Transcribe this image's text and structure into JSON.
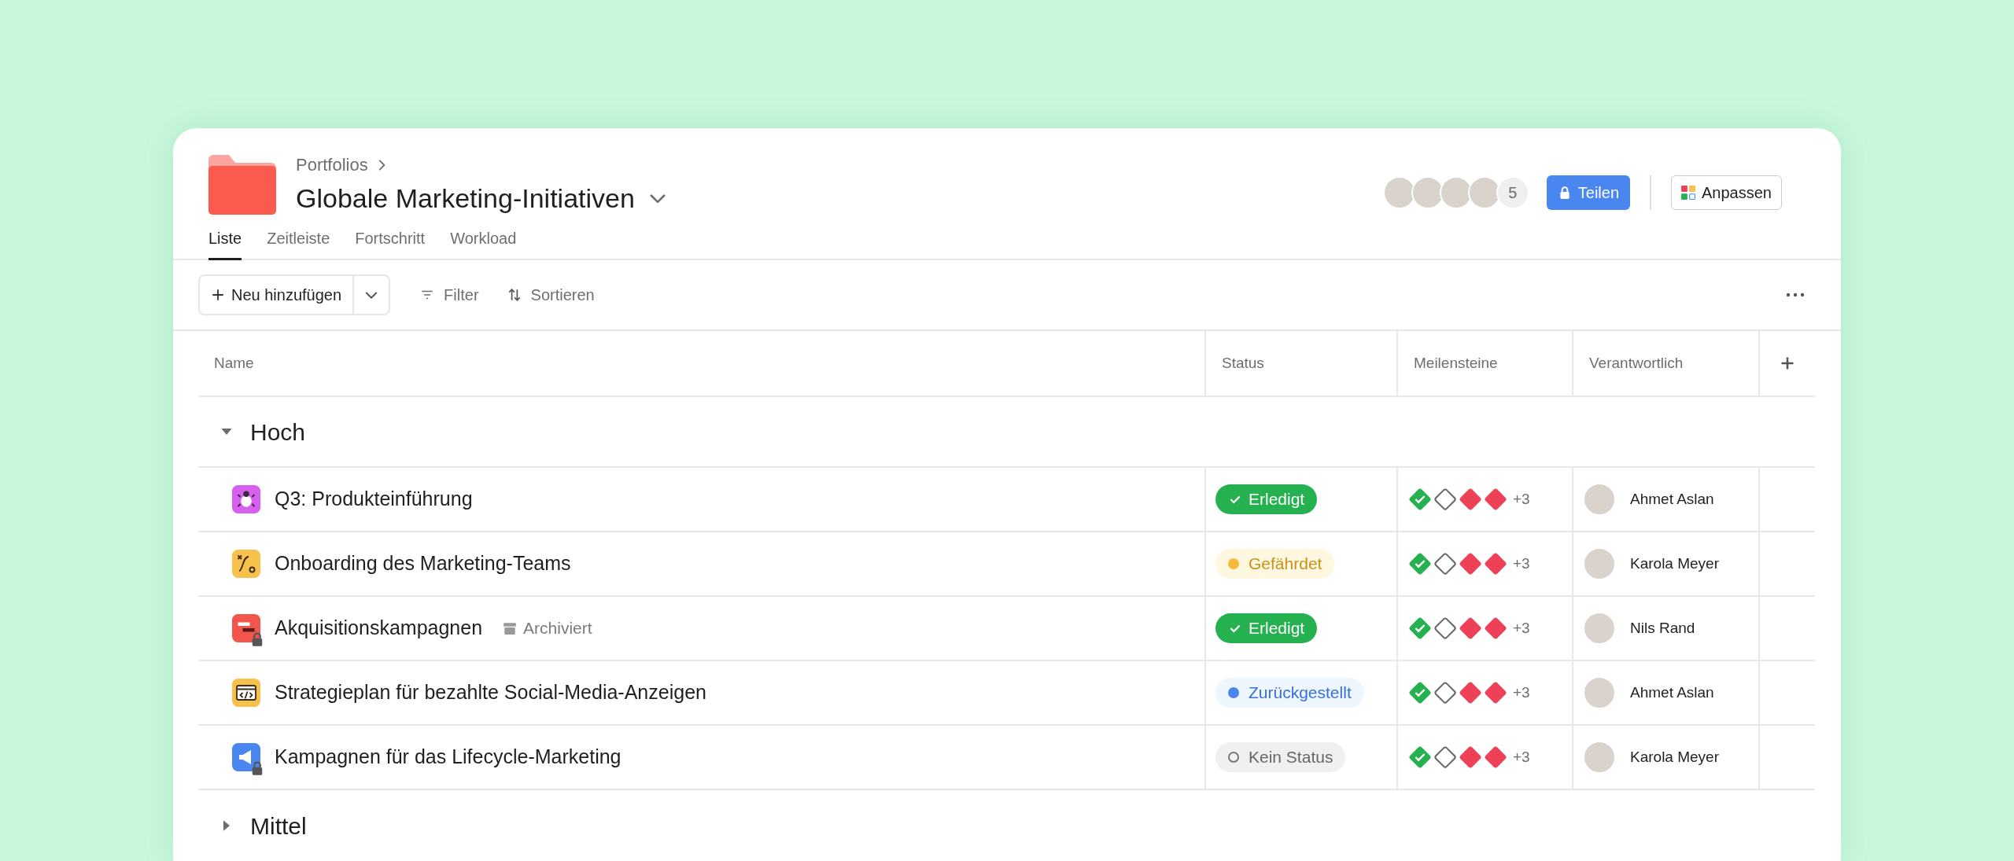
{
  "header": {
    "breadcrumb": "Portfolios",
    "title": "Globale Marketing-Initiativen",
    "member_count": "5",
    "share_button": "Teilen",
    "customize_button": "Anpassen"
  },
  "tabs": [
    {
      "label": "Liste",
      "selected": true
    },
    {
      "label": "Zeitleiste",
      "selected": false
    },
    {
      "label": "Fortschritt",
      "selected": false
    },
    {
      "label": "Workload",
      "selected": false
    }
  ],
  "toolbar": {
    "add_button": "Neu hinzufügen",
    "filter": "Filter",
    "sort": "Sortieren"
  },
  "table": {
    "columns": [
      "Name",
      "Status",
      "Meilensteine",
      "Verantwortlich"
    ],
    "groups": [
      {
        "title": "Hoch",
        "expanded": true,
        "rows": [
          {
            "name": "Q3: Produkteinführung",
            "kind": "bug",
            "color": "#d65fef",
            "locked": false,
            "status": {
              "kind": "done",
              "label": "Erledigt"
            },
            "milestones": [
              {
                "kind": "done"
              },
              {
                "kind": "open"
              },
              {
                "kind": "missed"
              },
              {
                "kind": "missed"
              }
            ],
            "more_milestones": "+3",
            "owner": "Ahmet Aslan"
          },
          {
            "name": "Onboarding des Marketing-Teams",
            "kind": "workflow",
            "color": "#f8c14c",
            "locked": false,
            "status": {
              "kind": "at_risk",
              "label": "Gefährdet"
            },
            "milestones": [
              {
                "kind": "done"
              },
              {
                "kind": "open"
              },
              {
                "kind": "missed"
              },
              {
                "kind": "missed"
              }
            ],
            "more_milestones": "+3",
            "owner": "Karola Meyer"
          },
          {
            "name": "Akquisitionskampagnen",
            "kind": "board",
            "color": "#f2554b",
            "locked": true,
            "archived_label": "Archiviert",
            "status": {
              "kind": "done",
              "label": "Erledigt"
            },
            "milestones": [
              {
                "kind": "done"
              },
              {
                "kind": "open"
              },
              {
                "kind": "missed"
              },
              {
                "kind": "missed"
              }
            ],
            "more_milestones": "+3",
            "owner": "Nils Rand"
          },
          {
            "name": "Strategieplan für bezahlte Social-Media-Anzeigen",
            "kind": "code",
            "color": "#f8c14c",
            "locked": false,
            "status": {
              "kind": "on_hold",
              "label": "Zurückgestellt"
            },
            "milestones": [
              {
                "kind": "done"
              },
              {
                "kind": "open"
              },
              {
                "kind": "missed"
              },
              {
                "kind": "missed"
              }
            ],
            "more_milestones": "+3",
            "owner": "Ahmet Aslan"
          },
          {
            "name": "Kampagnen für das Lifecycle-Marketing",
            "kind": "megaphone",
            "color": "#4a86f0",
            "locked": true,
            "status": {
              "kind": "none",
              "label": "Kein Status"
            },
            "milestones": [
              {
                "kind": "done"
              },
              {
                "kind": "open"
              },
              {
                "kind": "missed"
              },
              {
                "kind": "missed"
              }
            ],
            "more_milestones": "+3",
            "owner": "Karola Meyer"
          }
        ]
      },
      {
        "title": "Mittel",
        "expanded": false
      }
    ]
  }
}
